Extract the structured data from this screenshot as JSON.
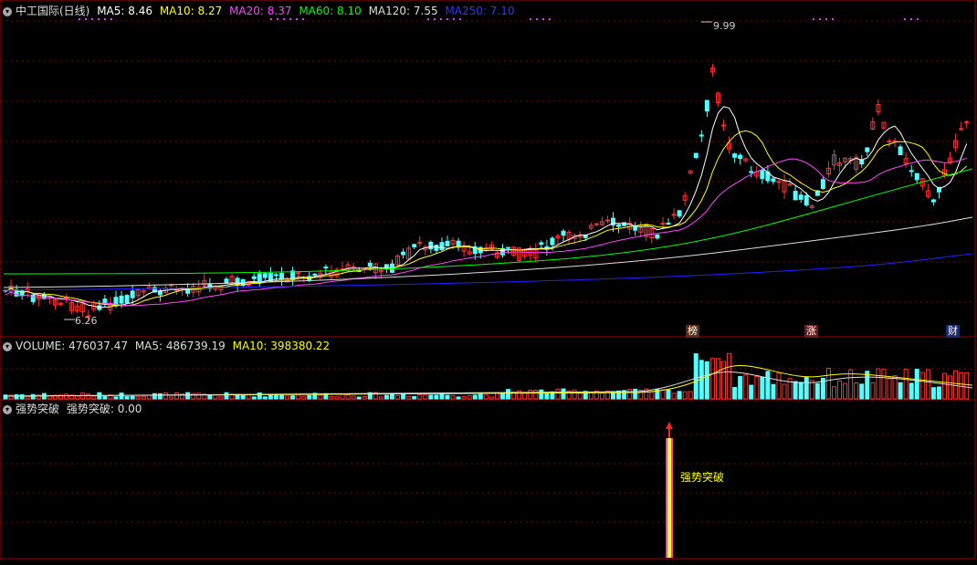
{
  "title": "中工国际(日线)",
  "price_header": [
    {
      "label": "MA5: 8.46",
      "color": "#ffffff"
    },
    {
      "label": "MA10: 8.27",
      "color": "#ffff00"
    },
    {
      "label": "MA20: 8.37",
      "color": "#ff44ff"
    },
    {
      "label": "MA60: 8.10",
      "color": "#00ff00"
    },
    {
      "label": "MA120: 7.55",
      "color": "#dddddd"
    },
    {
      "label": "MA250: 7.10",
      "color": "#2222ff"
    }
  ],
  "price_annotations": {
    "high": "9.99",
    "low": "6.26"
  },
  "event_tags": [
    "榜",
    "涨",
    "财"
  ],
  "volume_header": [
    {
      "label": "VOLUME: 476037.47",
      "color": "#dddddd"
    },
    {
      "label": "MA5: 486739.19",
      "color": "#dddddd"
    },
    {
      "label": "MA10: 398380.22",
      "color": "#ffff00"
    }
  ],
  "indicator_header": [
    {
      "label": "强势突破",
      "color": "#dddddd"
    },
    {
      "label": "强势突破: 0.00",
      "color": "#dddddd"
    }
  ],
  "indicator_label": "强势突破",
  "colors": {
    "up": "#ff3232",
    "down": "#54ffff",
    "grid": "#8a0000",
    "bg": "#000000"
  }
}
